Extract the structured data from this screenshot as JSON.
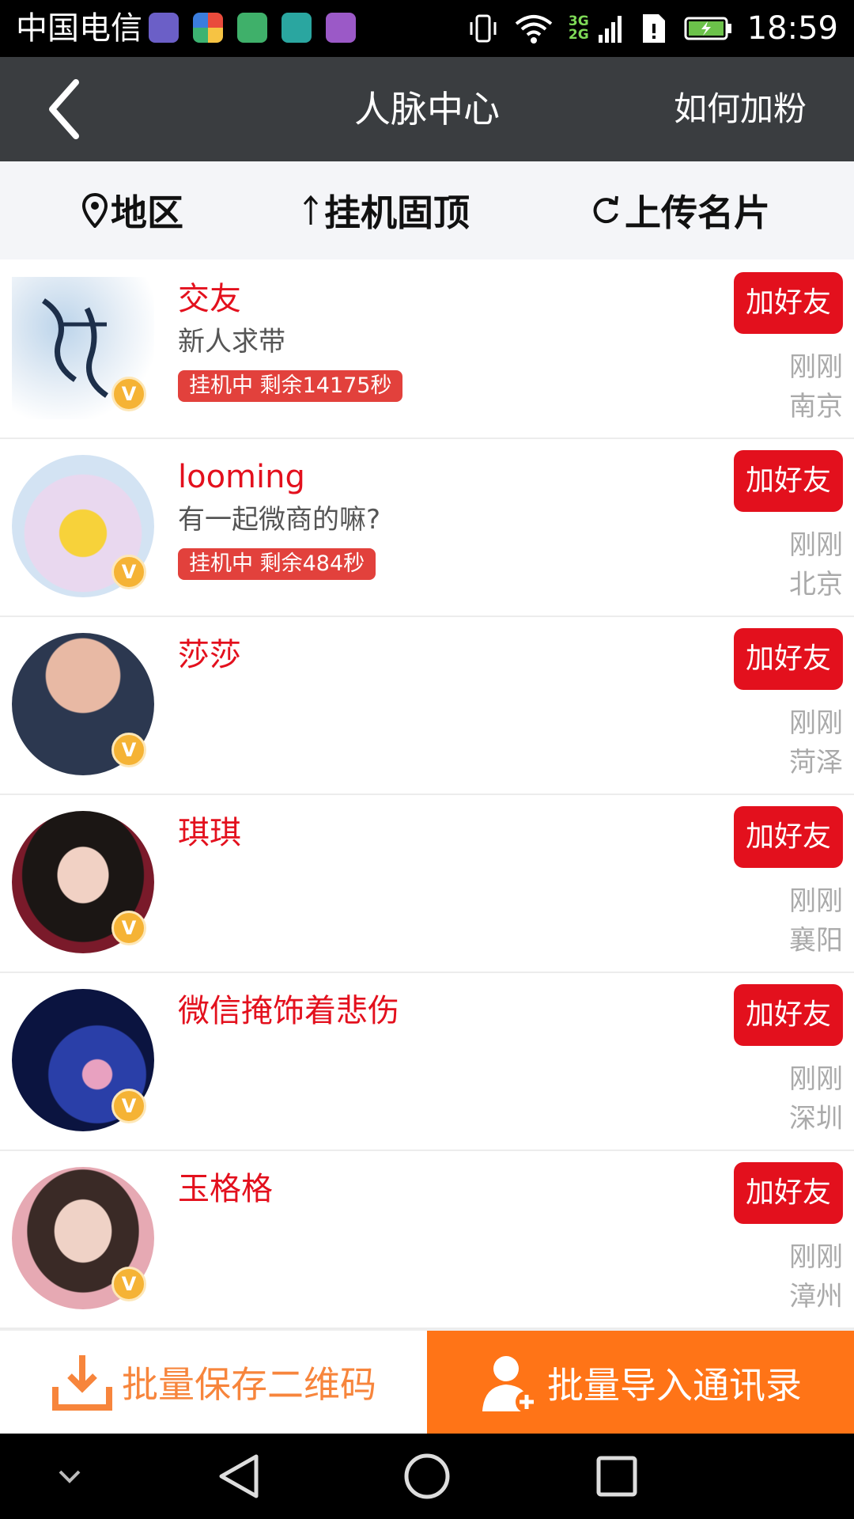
{
  "status_bar": {
    "carrier": "中国电信",
    "network_1": "3G",
    "network_2": "2G",
    "time": "18:59"
  },
  "header": {
    "title": "人脉中心",
    "action": "如何加粉"
  },
  "filters": [
    {
      "label": "地区",
      "icon": "location-pin-icon"
    },
    {
      "label": "挂机固顶",
      "icon": "arrow-up-icon"
    },
    {
      "label": "上传名片",
      "icon": "refresh-icon"
    }
  ],
  "contacts": [
    {
      "name": "交友",
      "subtitle": "新人求带",
      "hook": "挂机中 剩余14175秒",
      "button": "加好友",
      "time": "刚刚",
      "city": "南京",
      "badge": "V"
    },
    {
      "name": "looming",
      "subtitle": "有一起微商的嘛?",
      "hook": "挂机中 剩余484秒",
      "button": "加好友",
      "time": "刚刚",
      "city": "北京",
      "badge": "V"
    },
    {
      "name": "莎莎",
      "button": "加好友",
      "time": "刚刚",
      "city": "菏泽",
      "badge": "V"
    },
    {
      "name": "琪琪",
      "button": "加好友",
      "time": "刚刚",
      "city": "襄阳",
      "badge": "V"
    },
    {
      "name": "微信掩饰着悲伤",
      "button": "加好友",
      "time": "刚刚",
      "city": "深圳",
      "badge": "V"
    },
    {
      "name": "玉格格",
      "button": "加好友",
      "time": "刚刚",
      "city": "漳州",
      "badge": "V"
    }
  ],
  "bottom_bar": {
    "save_qr": "批量保存二维码",
    "import_contacts": "批量导入通讯录"
  },
  "colors": {
    "header_bg": "#3a3d40",
    "accent_red": "#e3101d",
    "accent_orange": "#ff7417"
  }
}
